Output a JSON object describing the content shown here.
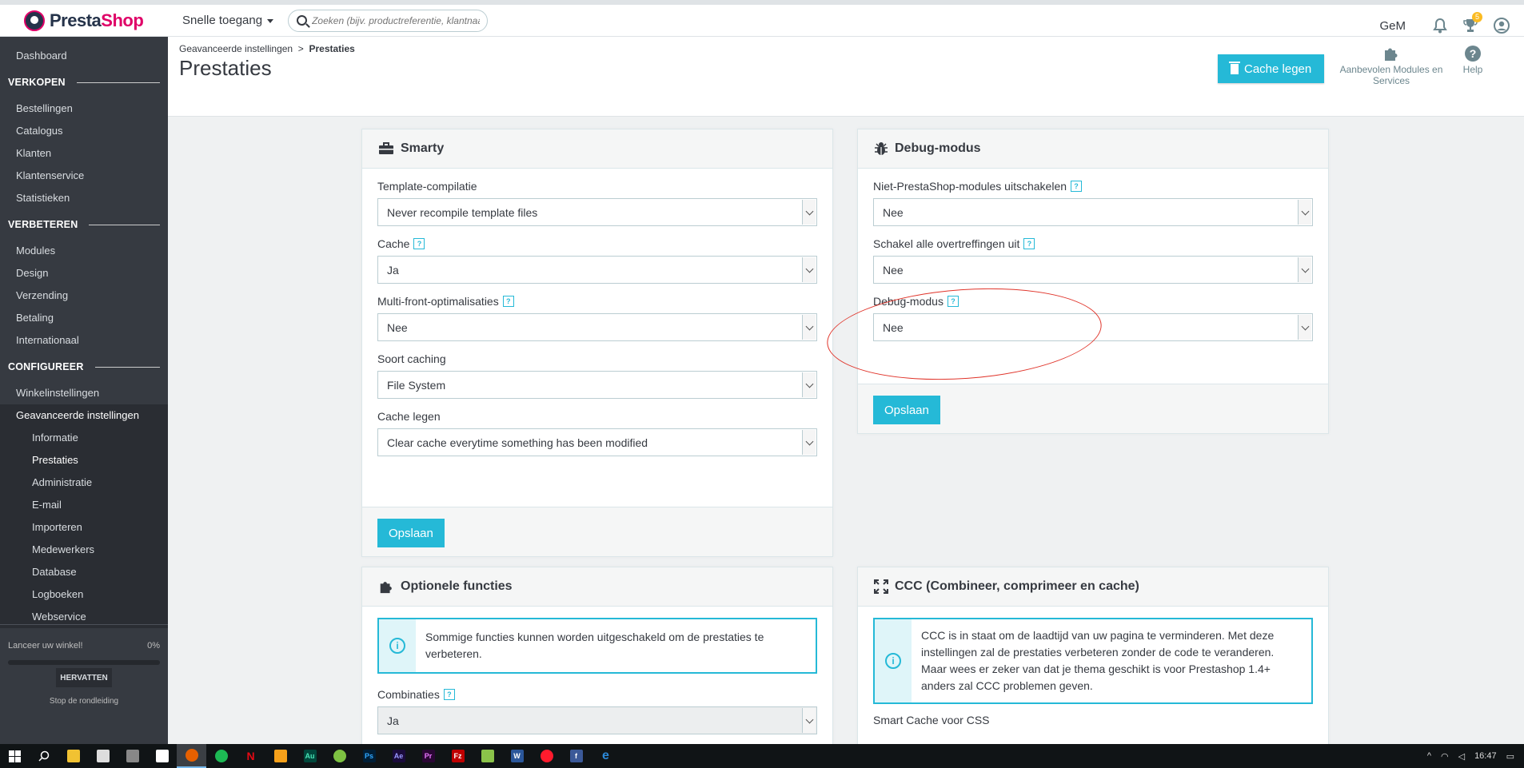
{
  "brand": {
    "name_a": "Presta",
    "name_b": "Shop"
  },
  "topbar": {
    "quick_access": "Snelle toegang",
    "search_placeholder": "Zoeken (bijv. productreferentie, klantnaam...)",
    "user_initials": "GeM",
    "trophy_count": "5"
  },
  "sidebar": {
    "dashboard": "Dashboard",
    "sections": [
      {
        "title": "VERKOPEN",
        "items": [
          "Bestellingen",
          "Catalogus",
          "Klanten",
          "Klantenservice",
          "Statistieken"
        ]
      },
      {
        "title": "VERBETEREN",
        "items": [
          "Modules",
          "Design",
          "Verzending",
          "Betaling",
          "Internationaal"
        ]
      },
      {
        "title": "CONFIGUREER",
        "items": [
          "Winkelinstellingen",
          "Geavanceerde instellingen"
        ]
      }
    ],
    "subitems": [
      "Informatie",
      "Prestaties",
      "Administratie",
      "E-mail",
      "Importeren",
      "Medewerkers",
      "Database",
      "Logboeken",
      "Webservice"
    ],
    "onboarding": {
      "label": "Lanceer uw winkel!",
      "percent": "0%",
      "progress": 0,
      "resume": "HERVATTEN",
      "stop": "Stop de rondleiding"
    }
  },
  "header": {
    "breadcrumb_parent": "Geavanceerde instellingen",
    "breadcrumb_sep": ">",
    "breadcrumb_current": "Prestaties",
    "title": "Prestaties",
    "clear_cache": "Cache legen",
    "modules_link": "Aanbevolen Modules en Services",
    "help": "Help"
  },
  "smarty": {
    "title": "Smarty",
    "fields": [
      {
        "label": "Template-compilatie",
        "value": "Never recompile template files",
        "help": false
      },
      {
        "label": "Cache",
        "value": "Ja",
        "help": true
      },
      {
        "label": "Multi-front-optimalisaties",
        "value": "Nee",
        "help": true
      },
      {
        "label": "Soort caching",
        "value": "File System",
        "help": false
      },
      {
        "label": "Cache legen",
        "value": "Clear cache everytime something has been modified",
        "help": false
      }
    ],
    "save": "Opslaan"
  },
  "debug": {
    "title": "Debug-modus",
    "fields": [
      {
        "label": "Niet-PrestaShop-modules uitschakelen",
        "value": "Nee",
        "help": true
      },
      {
        "label": "Schakel alle overtreffingen uit",
        "value": "Nee",
        "help": true
      },
      {
        "label": "Debug-modus",
        "value": "Nee",
        "help": true
      }
    ],
    "save": "Opslaan"
  },
  "optional": {
    "title": "Optionele functies",
    "info": "Sommige functies kunnen worden uitgeschakeld om de prestaties te verbeteren.",
    "field_label": "Combinaties",
    "field_value": "Ja"
  },
  "ccc": {
    "title": "CCC (Combineer, comprimeer en cache)",
    "info": "CCC is in staat om de laadtijd van uw pagina te verminderen. Met deze instellingen zal de prestaties verbeteren zonder de code te veranderen. Maar wees er zeker van dat je thema geschikt is voor Prestashop 1.4+ anders zal CCC problemen geven.",
    "field_label": "Smart Cache voor CSS"
  },
  "help_mark": "?",
  "info_mark": "i",
  "taskbar": {
    "clock": "16:47",
    "apps": [
      "search",
      "file-explorer",
      "store",
      "calculator",
      "mail",
      "firefox",
      "spotify",
      "netflix",
      "fl-studio",
      "audition",
      "xbox",
      "photoshop",
      "after-effects",
      "premiere",
      "filezilla",
      "notepad",
      "word",
      "opera",
      "facebook",
      "edge"
    ],
    "app_labels": {
      "audition": "Au",
      "photoshop": "Ps",
      "after-effects": "Ae",
      "premiere": "Pr",
      "word": "W",
      "facebook": "f",
      "netflix": "N",
      "edge": "e",
      "filezilla": "Fz"
    }
  },
  "colors": {
    "accent": "#25b9d7",
    "brand_pink": "#df0067",
    "sidebar": "#363a41",
    "highlight_ellipse": "#e0342a"
  }
}
